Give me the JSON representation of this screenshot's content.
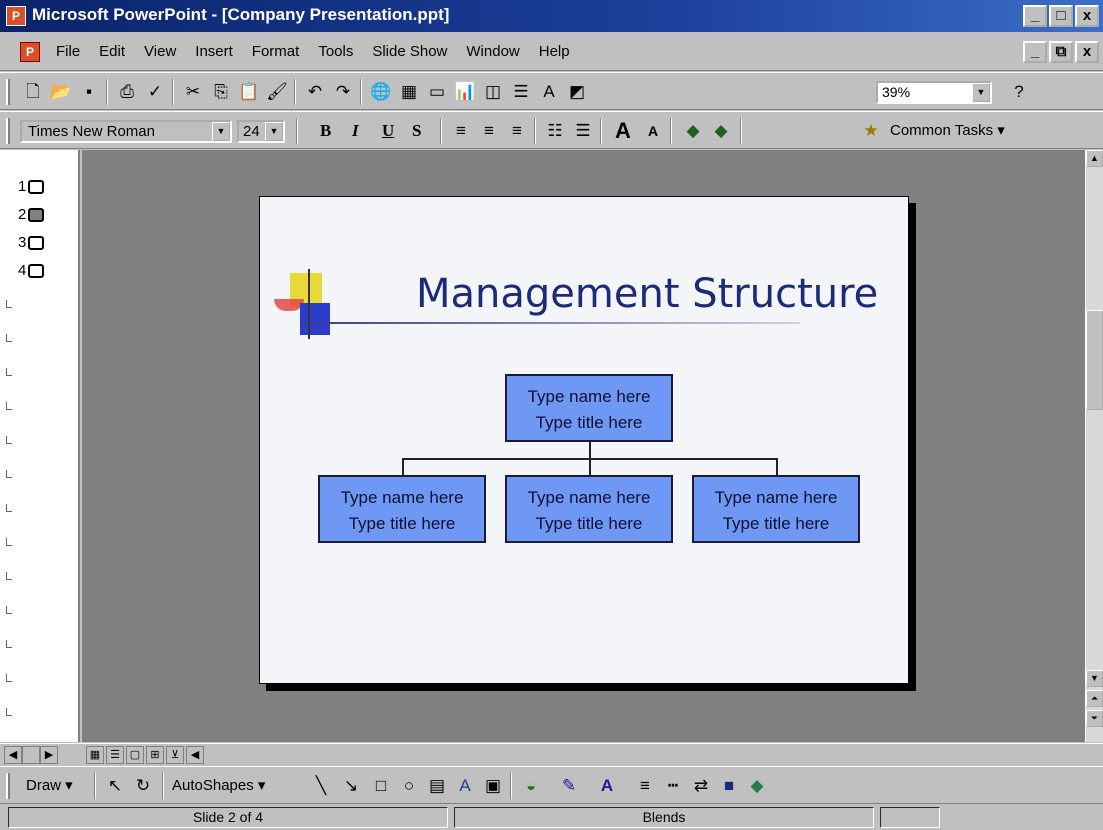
{
  "window": {
    "title": "Microsoft PowerPoint - [Company Presentation.ppt]",
    "minimize": "_",
    "restore": "□",
    "close": "x"
  },
  "menu": {
    "items": [
      "File",
      "Edit",
      "View",
      "Insert",
      "Format",
      "Tools",
      "Slide Show",
      "Window",
      "Help"
    ],
    "doc_minimize": "_",
    "doc_restore": "⧉",
    "doc_close": "x"
  },
  "standard_toolbar": {
    "zoom": "39%",
    "help_icon": "help-icon"
  },
  "format_toolbar": {
    "font_name": "Times New Roman",
    "font_size": "24",
    "bold": "B",
    "italic": "I",
    "underline": "U",
    "shadow": "S",
    "common_tasks": "Common Tasks"
  },
  "outline": {
    "slides": [
      "1",
      "2",
      "3",
      "4"
    ],
    "active_slide": "2"
  },
  "slide": {
    "title": "Management Structure",
    "org_chart": {
      "top": {
        "name": "Type name here",
        "title": "Type title here"
      },
      "children": [
        {
          "name": "Type name here",
          "title": "Type title here"
        },
        {
          "name": "Type name here",
          "title": "Type title here"
        },
        {
          "name": "Type name here",
          "title": "Type title here"
        }
      ]
    }
  },
  "drawing_toolbar": {
    "draw": "Draw",
    "autoshapes": "AutoShapes"
  },
  "status": {
    "slide_position": "Slide 2 of 4",
    "design": "Blends"
  },
  "colors": {
    "org_box_fill": "#6f98f5",
    "title_color": "#1c2a7a",
    "titlebar": "#0a246a"
  }
}
